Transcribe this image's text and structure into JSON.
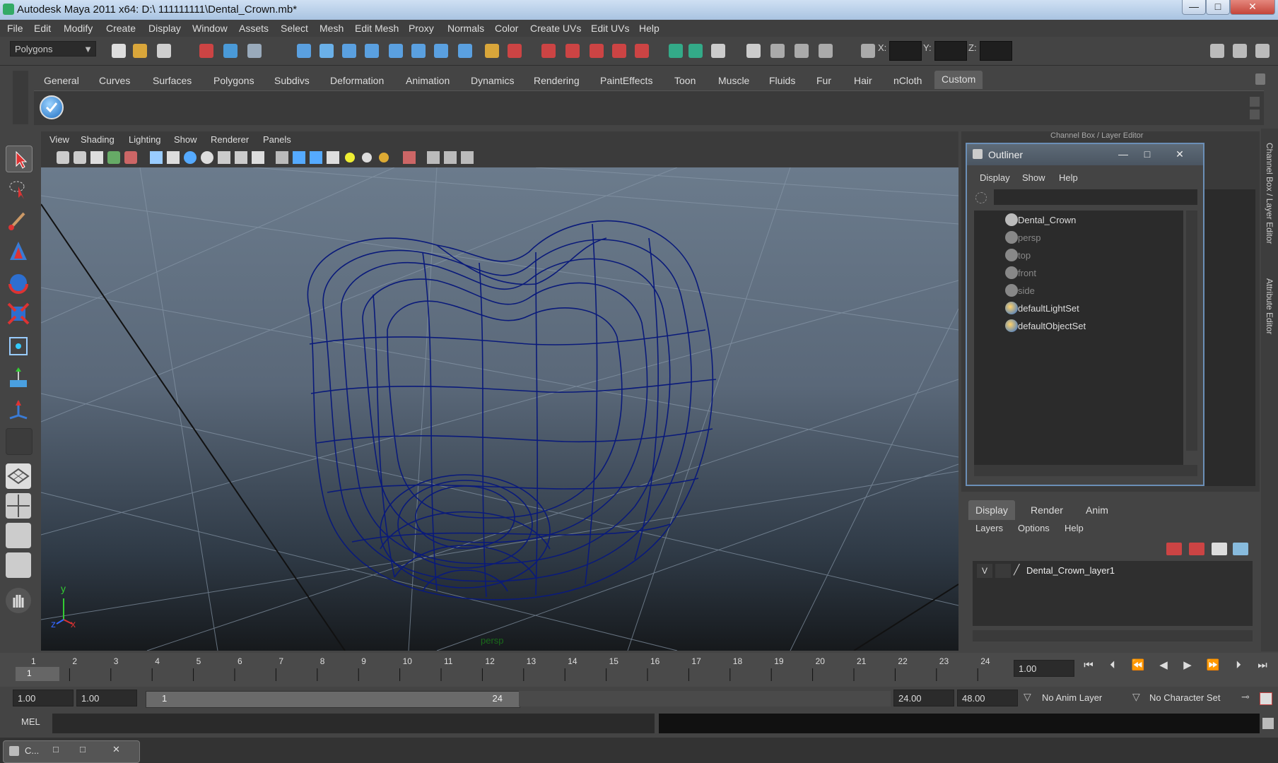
{
  "window": {
    "title": "Autodesk Maya 2011 x64: D:\\ 111111111\\Dental_Crown.mb*",
    "minimize": "—",
    "maximize": "□",
    "close": "✕"
  },
  "menu": [
    "File",
    "Edit",
    "Modify",
    "Create",
    "Display",
    "Window",
    "Assets",
    "Select",
    "Mesh",
    "Edit Mesh",
    "Proxy",
    "Normals",
    "Color",
    "Create UVs",
    "Edit UVs",
    "Help"
  ],
  "status": {
    "mode": "Polygons",
    "x_label": "X:",
    "y_label": "Y:",
    "z_label": "Z:"
  },
  "shelf_tabs": [
    "General",
    "Curves",
    "Surfaces",
    "Polygons",
    "Subdivs",
    "Deformation",
    "Animation",
    "Dynamics",
    "Rendering",
    "PaintEffects",
    "Toon",
    "Muscle",
    "Fluids",
    "Fur",
    "Hair",
    "nCloth",
    "Custom"
  ],
  "viewport": {
    "menus": [
      "View",
      "Shading",
      "Lighting",
      "Show",
      "Renderer",
      "Panels"
    ],
    "camera_label": "persp",
    "axis_y": "y",
    "axis_x": "x",
    "axis_z": "z"
  },
  "outliner": {
    "title": "Outliner",
    "menus": [
      "Display",
      "Show",
      "Help"
    ],
    "items": [
      {
        "label": "Dental_Crown",
        "dim": false,
        "kind": "mesh"
      },
      {
        "label": "persp",
        "dim": true,
        "kind": "camera"
      },
      {
        "label": "top",
        "dim": true,
        "kind": "camera"
      },
      {
        "label": "front",
        "dim": true,
        "kind": "camera"
      },
      {
        "label": "side",
        "dim": true,
        "kind": "camera"
      },
      {
        "label": "defaultLightSet",
        "dim": false,
        "kind": "set"
      },
      {
        "label": "defaultObjectSet",
        "dim": false,
        "kind": "set"
      }
    ]
  },
  "channel_box_label": "Channel Box / Layer Editor",
  "side_tabs": {
    "channel": "Channel Box / Layer Editor",
    "attribute": "Attribute Editor"
  },
  "layer_editor": {
    "tabs": [
      "Display",
      "Render",
      "Anim"
    ],
    "menus": [
      "Layers",
      "Options",
      "Help"
    ],
    "layer_visible": "V",
    "layer_name": "Dental_Crown_layer1"
  },
  "timeline": {
    "ticks": [
      "1",
      "2",
      "3",
      "4",
      "5",
      "6",
      "7",
      "8",
      "9",
      "10",
      "11",
      "12",
      "13",
      "14",
      "15",
      "16",
      "17",
      "18",
      "19",
      "20",
      "21",
      "22",
      "23",
      "24"
    ],
    "current_frame": "1",
    "current_time": "1.00"
  },
  "range": {
    "start": "1.00",
    "start2": "1.00",
    "slider_start": "1",
    "slider_end": "24",
    "end": "24.00",
    "end2": "48.00",
    "anim_layer": "No Anim Layer",
    "char_set": "No Character Set"
  },
  "mel": {
    "label": "MEL"
  },
  "taskbar": {
    "label": "C..."
  },
  "colors": {
    "wire": "#0a1a7a",
    "accent": "#6b8fb7"
  }
}
